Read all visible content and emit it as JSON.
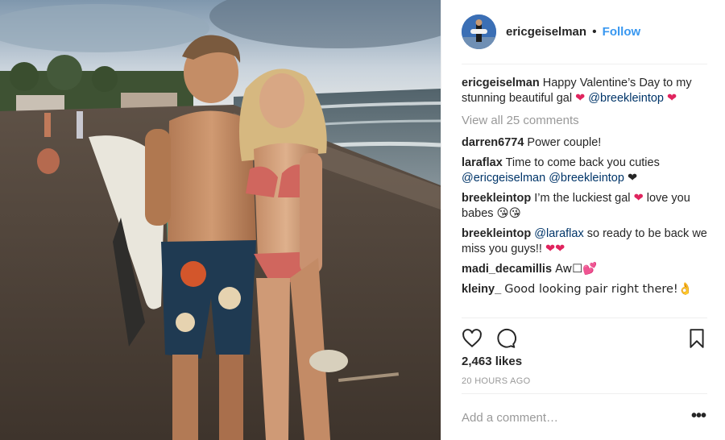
{
  "post": {
    "author": "ericgeiselman",
    "follow_label": "Follow",
    "separator": "•"
  },
  "caption": {
    "user": "ericgeiselman",
    "text": "Happy Valentine’s Day to my stunning beautiful gal",
    "mention": "@breekleintop"
  },
  "view_all": "View all 25 comments",
  "comments": [
    {
      "user": "darren6774",
      "text": "Power couple!"
    },
    {
      "user": "laraflax",
      "text": "Time to come back you cuties",
      "mentions": "@ericgeiselman @breekleintop",
      "emoji": "❤"
    },
    {
      "user": "breekleintop",
      "text": "I’m the luckiest gal",
      "text2": "love you babes",
      "emoji": "😘😘"
    },
    {
      "user": "breekleintop",
      "mention": "@laraflax",
      "text": "so ready to be back we miss you guys!!"
    },
    {
      "user": "madi_decamillis",
      "text": "Aw☐💕"
    },
    {
      "user": "kleiny_",
      "text": "Good looking pair right there!👌"
    }
  ],
  "likes": "2,463 likes",
  "timestamp": "20 HOURS AGO",
  "add_comment": {
    "placeholder": "Add a comment…"
  },
  "more_label": "•••",
  "icons": {
    "like": "heart-outline-icon",
    "comment": "speech-bubble-icon",
    "save": "bookmark-icon",
    "more": "more-options-icon"
  },
  "colors": {
    "follow": "#3897f0",
    "mention": "#003569",
    "muted": "#999999",
    "heart": "#e0245e"
  }
}
